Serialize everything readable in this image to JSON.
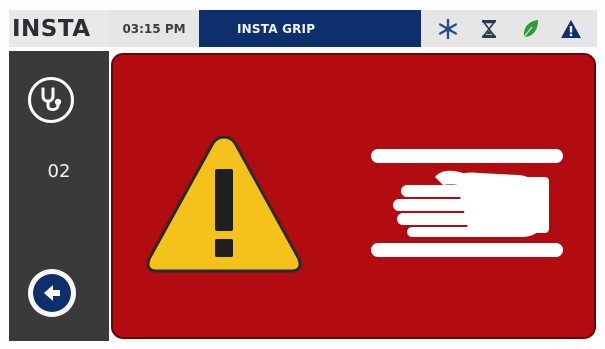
{
  "header": {
    "brand": "INSTA",
    "time": "03:15 PM",
    "title": "INSTA GRIP"
  },
  "status_icons": [
    {
      "name": "snowflake-icon",
      "color": "#2a4d86"
    },
    {
      "name": "hourglass-icon",
      "color": "#2b3a4e"
    },
    {
      "name": "leaf-icon",
      "color": "#2f9a3a"
    },
    {
      "name": "warning-icon",
      "color": "#0d2f6c"
    }
  ],
  "sidebar": {
    "count": "02",
    "stethoscope_icon": "stethoscope-icon",
    "back_icon": "arrow-left-icon"
  },
  "alert": {
    "background": "#b20b10",
    "warning_icon": "warning-triangle-icon",
    "hand_icon": "hand-icon"
  }
}
